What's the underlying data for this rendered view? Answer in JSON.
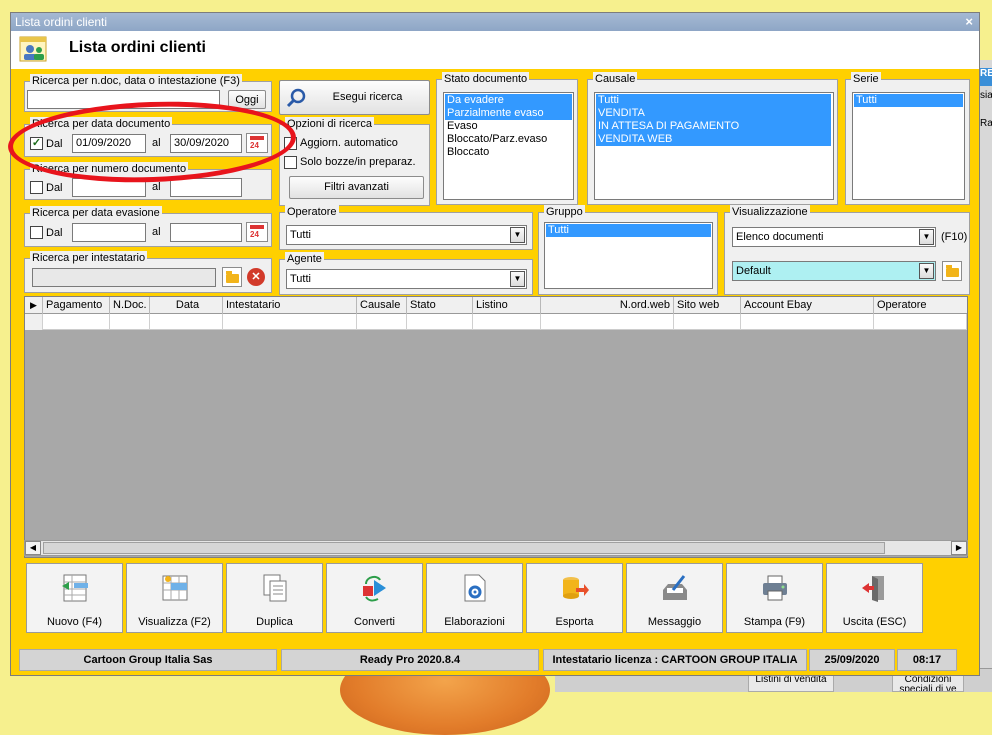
{
  "window": {
    "title": "Lista ordini clienti",
    "close": "×"
  },
  "header": {
    "title": "Lista ordini clienti"
  },
  "background": {
    "tab": "RE",
    "text1": "sia",
    "text2": "Rar",
    "cells": [
      "Listini di vendita",
      "Condizioni speciali di ve"
    ]
  },
  "search_doc": {
    "legend": "Ricerca per n.doc, data o intestazione (F3)",
    "value": "",
    "oggi_label": "Oggi"
  },
  "search_date": {
    "legend": "Ricerca per data documento",
    "checked": true,
    "dal_label": "Dal",
    "al_label": "al",
    "from": "01/09/2020",
    "to": "30/09/2020",
    "cal_num": "24"
  },
  "search_number": {
    "legend": "Ricerca per numero documento",
    "dal_label": "Dal",
    "al_label": "al",
    "from": "",
    "to": ""
  },
  "search_evasion": {
    "legend": "Ricerca per data evasione",
    "dal_label": "Dal",
    "al_label": "al",
    "from": "",
    "to": "",
    "cal_num": "24"
  },
  "search_holder": {
    "legend": "Ricerca per intestatario",
    "value": ""
  },
  "search_button": {
    "label": "Esegui ricerca"
  },
  "options": {
    "legend": "Opzioni di ricerca",
    "auto_update": "Aggiorn. automatico",
    "drafts_only": "Solo bozze/in preparaz.",
    "advanced_filters": "Filtri avanzati"
  },
  "stato": {
    "legend": "Stato documento",
    "items": [
      {
        "label": "Da evadere",
        "selected": true
      },
      {
        "label": "Parzialmente evaso",
        "selected": true
      },
      {
        "label": "Evaso",
        "selected": false
      },
      {
        "label": "Bloccato/Parz.evaso",
        "selected": false
      },
      {
        "label": "Bloccato",
        "selected": false
      }
    ]
  },
  "causale": {
    "legend": "Causale",
    "items": [
      {
        "label": "Tutti",
        "selected": true
      },
      {
        "label": "VENDITA",
        "selected": true
      },
      {
        "label": "IN ATTESA DI PAGAMENTO",
        "selected": true
      },
      {
        "label": "VENDITA WEB",
        "selected": true
      }
    ]
  },
  "serie": {
    "legend": "Serie",
    "items": [
      {
        "label": "Tutti",
        "selected": true
      }
    ]
  },
  "operatore": {
    "legend": "Operatore",
    "value": "Tutti"
  },
  "agente": {
    "legend": "Agente",
    "value": "Tutti"
  },
  "gruppo": {
    "legend": "Gruppo",
    "items": [
      {
        "label": "Tutti",
        "selected": true
      }
    ]
  },
  "visualizzazione": {
    "legend": "Visualizzazione",
    "mode": "Elenco documenti",
    "shortcut": "(F10)",
    "layout": "Default"
  },
  "grid": {
    "columns": [
      "Pagamento",
      "N.Doc.",
      "Data",
      "Intestatario",
      "Causale",
      "Stato",
      "Listino",
      "N.ord.web",
      "Sito web",
      "Account Ebay",
      "Operatore"
    ]
  },
  "toolbar": [
    {
      "label": "Nuovo (F4)",
      "icon": "new-document-icon"
    },
    {
      "label": "Visualizza (F2)",
      "icon": "view-table-icon"
    },
    {
      "label": "Duplica",
      "icon": "duplicate-icon"
    },
    {
      "label": "Converti",
      "icon": "convert-icon"
    },
    {
      "label": "Elaborazioni",
      "icon": "gear-document-icon"
    },
    {
      "label": "Esporta",
      "icon": "export-icon"
    },
    {
      "label": "Messaggio",
      "icon": "message-icon"
    },
    {
      "label": "Stampa (F9)",
      "icon": "printer-icon"
    },
    {
      "label": "Uscita (ESC)",
      "icon": "exit-door-icon"
    }
  ],
  "statusbar": {
    "company": "Cartoon Group Italia Sas",
    "version": "Ready Pro 2020.8.4",
    "license": "Intestatario licenza : CARTOON GROUP ITALIA",
    "date": "25/09/2020",
    "time": "08:17"
  },
  "colors": {
    "window_bg": "#ffd000",
    "selection": "#3399ff",
    "annotation": "#e8141c",
    "layout_combo": "#aef0f2"
  }
}
